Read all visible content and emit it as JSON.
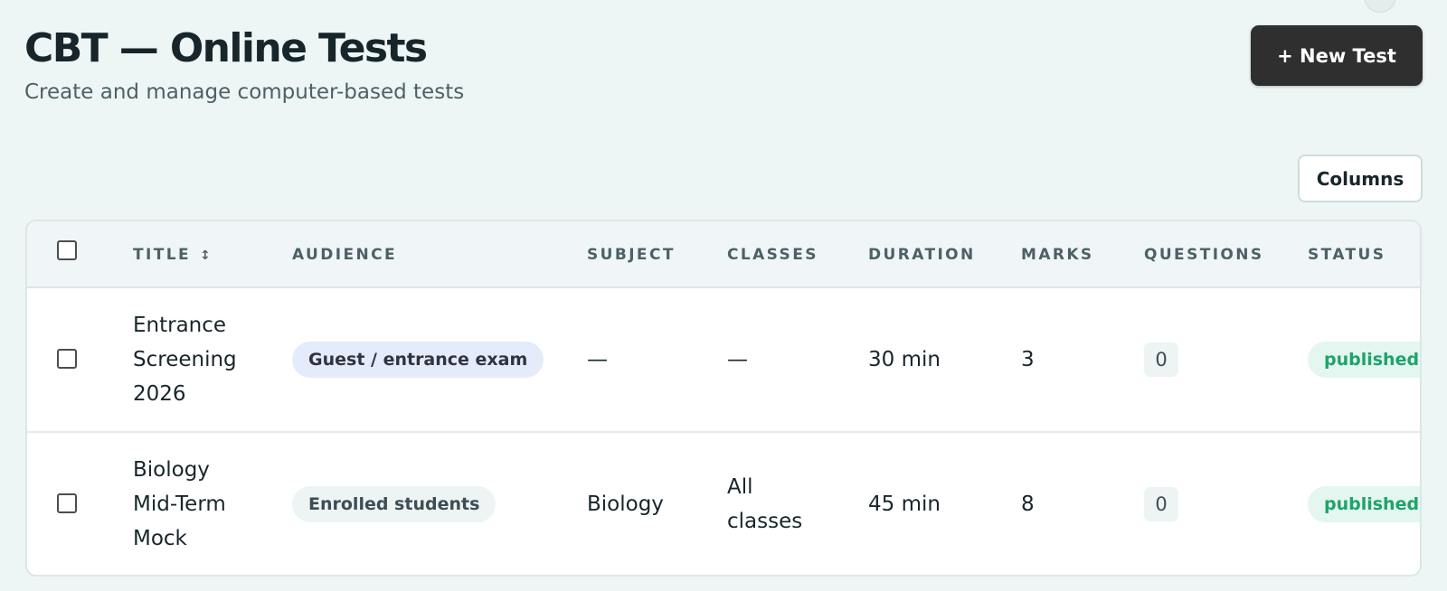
{
  "header": {
    "title": "CBT — Online Tests",
    "subtitle": "Create and manage computer-based tests",
    "new_test_label": "+ New Test"
  },
  "toolbar": {
    "columns_label": "Columns"
  },
  "table": {
    "columns": {
      "title": "TITLE",
      "audience": "AUDIENCE",
      "subject": "SUBJECT",
      "classes": "CLASSES",
      "duration": "DURATION",
      "marks": "MARKS",
      "questions": "QUESTIONS",
      "status": "STATUS"
    },
    "sort_icon": "↕",
    "rows": [
      {
        "title_lines": [
          "Entrance",
          "Screening",
          "2026"
        ],
        "audience": "Guest / entrance exam",
        "subject": "—",
        "classes_lines": [
          "—"
        ],
        "duration": "30 min",
        "marks": "3",
        "questions": "0",
        "status": "published"
      },
      {
        "title_lines": [
          "Biology",
          "Mid-Term",
          "Mock"
        ],
        "audience": "Enrolled students",
        "subject": "Biology",
        "classes_lines": [
          "All",
          "classes"
        ],
        "duration": "45 min",
        "marks": "8",
        "questions": "0",
        "status": "published"
      }
    ]
  },
  "colors": {
    "background": "#eef6f5",
    "primary_button": "#2f2f2f",
    "status_published_text": "#1fa36b",
    "status_published_bg": "#e3f6ef",
    "audience_guest_bg": "#e4ebfb",
    "audience_enrolled_bg": "#eef3f4"
  }
}
